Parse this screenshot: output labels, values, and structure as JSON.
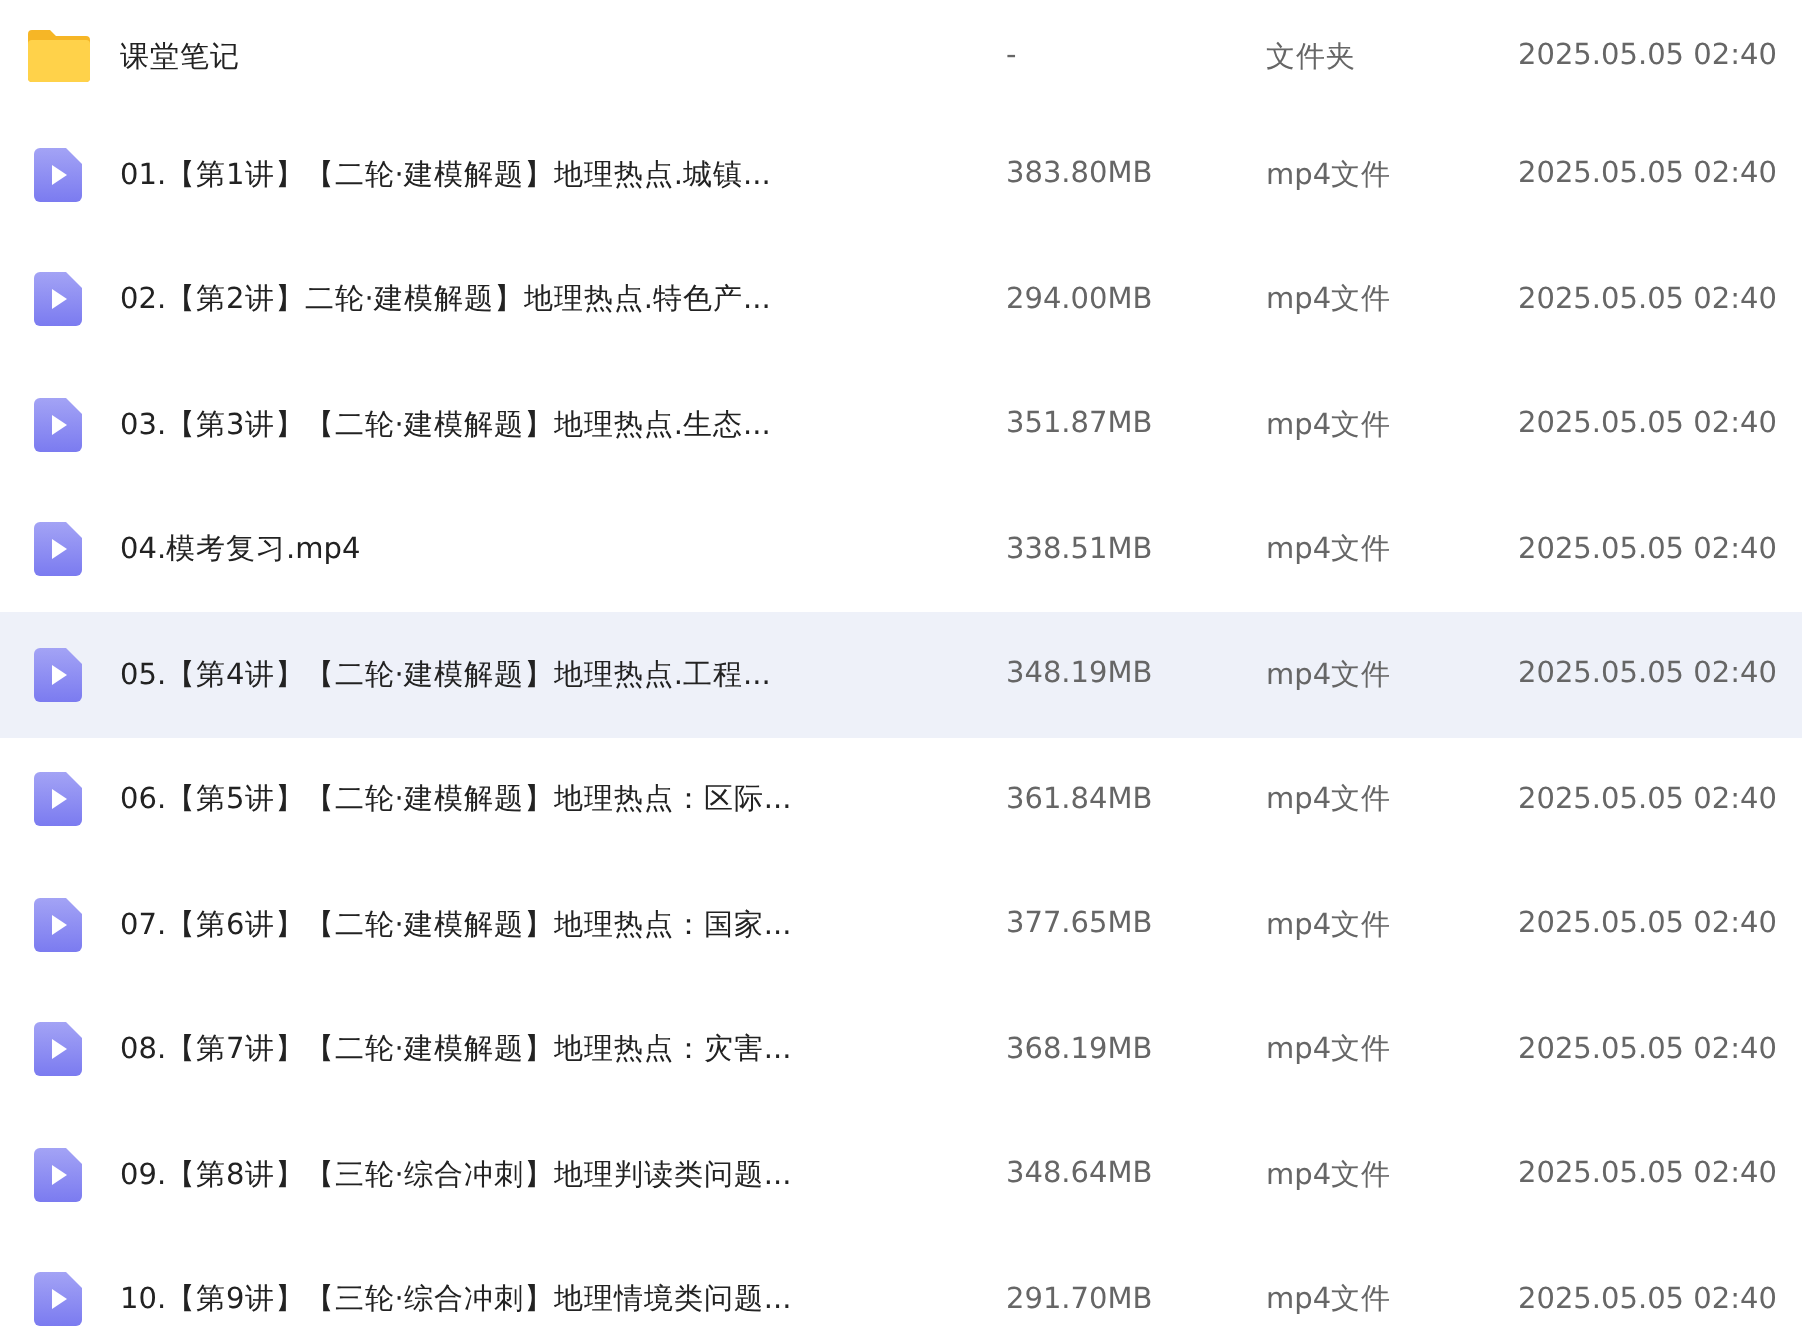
{
  "files": [
    {
      "kind": "folder",
      "name": "课堂笔记",
      "size": "-",
      "type": "文件夹",
      "modified": "2025.05.05 02:40",
      "selected": false
    },
    {
      "kind": "video",
      "name": "01.【第1讲】【二轮·建模解题】地理热点.城镇...",
      "size": "383.80MB",
      "type": "mp4文件",
      "modified": "2025.05.05 02:40",
      "selected": false
    },
    {
      "kind": "video",
      "name": "02.【第2讲】二轮·建模解题】地理热点.特色产...",
      "size": "294.00MB",
      "type": "mp4文件",
      "modified": "2025.05.05 02:40",
      "selected": false
    },
    {
      "kind": "video",
      "name": "03.【第3讲】【二轮·建模解题】地理热点.生态...",
      "size": "351.87MB",
      "type": "mp4文件",
      "modified": "2025.05.05 02:40",
      "selected": false
    },
    {
      "kind": "video",
      "name": "04.模考复习.mp4",
      "size": "338.51MB",
      "type": "mp4文件",
      "modified": "2025.05.05 02:40",
      "selected": false
    },
    {
      "kind": "video",
      "name": "05.【第4讲】【二轮·建模解题】地理热点.工程...",
      "size": "348.19MB",
      "type": "mp4文件",
      "modified": "2025.05.05 02:40",
      "selected": true
    },
    {
      "kind": "video",
      "name": "06.【第5讲】【二轮·建模解题】地理热点：区际...",
      "size": "361.84MB",
      "type": "mp4文件",
      "modified": "2025.05.05 02:40",
      "selected": false
    },
    {
      "kind": "video",
      "name": "07.【第6讲】【二轮·建模解题】地理热点：国家...",
      "size": "377.65MB",
      "type": "mp4文件",
      "modified": "2025.05.05 02:40",
      "selected": false
    },
    {
      "kind": "video",
      "name": "08.【第7讲】【二轮·建模解题】地理热点：灾害...",
      "size": "368.19MB",
      "type": "mp4文件",
      "modified": "2025.05.05 02:40",
      "selected": false
    },
    {
      "kind": "video",
      "name": "09.【第8讲】【三轮·综合冲刺】地理判读类问题...",
      "size": "348.64MB",
      "type": "mp4文件",
      "modified": "2025.05.05 02:40",
      "selected": false
    },
    {
      "kind": "video",
      "name": "10.【第9讲】【三轮·综合冲刺】地理情境类问题...",
      "size": "291.70MB",
      "type": "mp4文件",
      "modified": "2025.05.05 02:40",
      "selected": false
    }
  ]
}
